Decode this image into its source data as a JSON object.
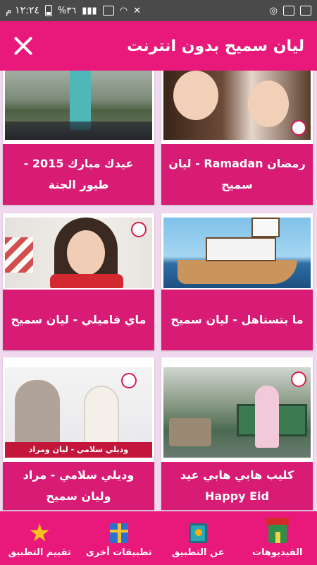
{
  "status_bar": {
    "time": "١٢:٢٤ م",
    "battery": "%٣٦"
  },
  "header": {
    "title": "ليان سميح بدون انترنت"
  },
  "videos": [
    {
      "title": "رمضان Ramadan - ليان سميح"
    },
    {
      "title": "عيدك مبارك 2015 - طيور الجنة"
    },
    {
      "title": "ما بتستاهل - ليان سميح"
    },
    {
      "title": "ماي فاميلي - ليان سميح"
    },
    {
      "title": "كليب هابي هابي عيد Happy Eid"
    },
    {
      "title": "وديلي سلامي - مراد وليان سميح",
      "overlay": "وديلي سلامي - ليان ومراد"
    }
  ],
  "bottom_nav": {
    "videos": "الفيديوهات",
    "about": "عن التطبيق",
    "more_apps": "تطبيقات أخرى",
    "rate": "تقييم التطبيق"
  },
  "colors": {
    "primary": "#e8197a",
    "caption": "#d81b74",
    "background": "#f0d9ee",
    "status_bar": "#4a4a4a"
  },
  "icons": [
    "image-icon",
    "cloud-icon",
    "wifi-icon",
    "mute-icon",
    "alarm-icon",
    "battery-icon",
    "signal-icon",
    "close-icon",
    "house-icon",
    "film-icon",
    "gift-icon",
    "star-icon"
  ]
}
